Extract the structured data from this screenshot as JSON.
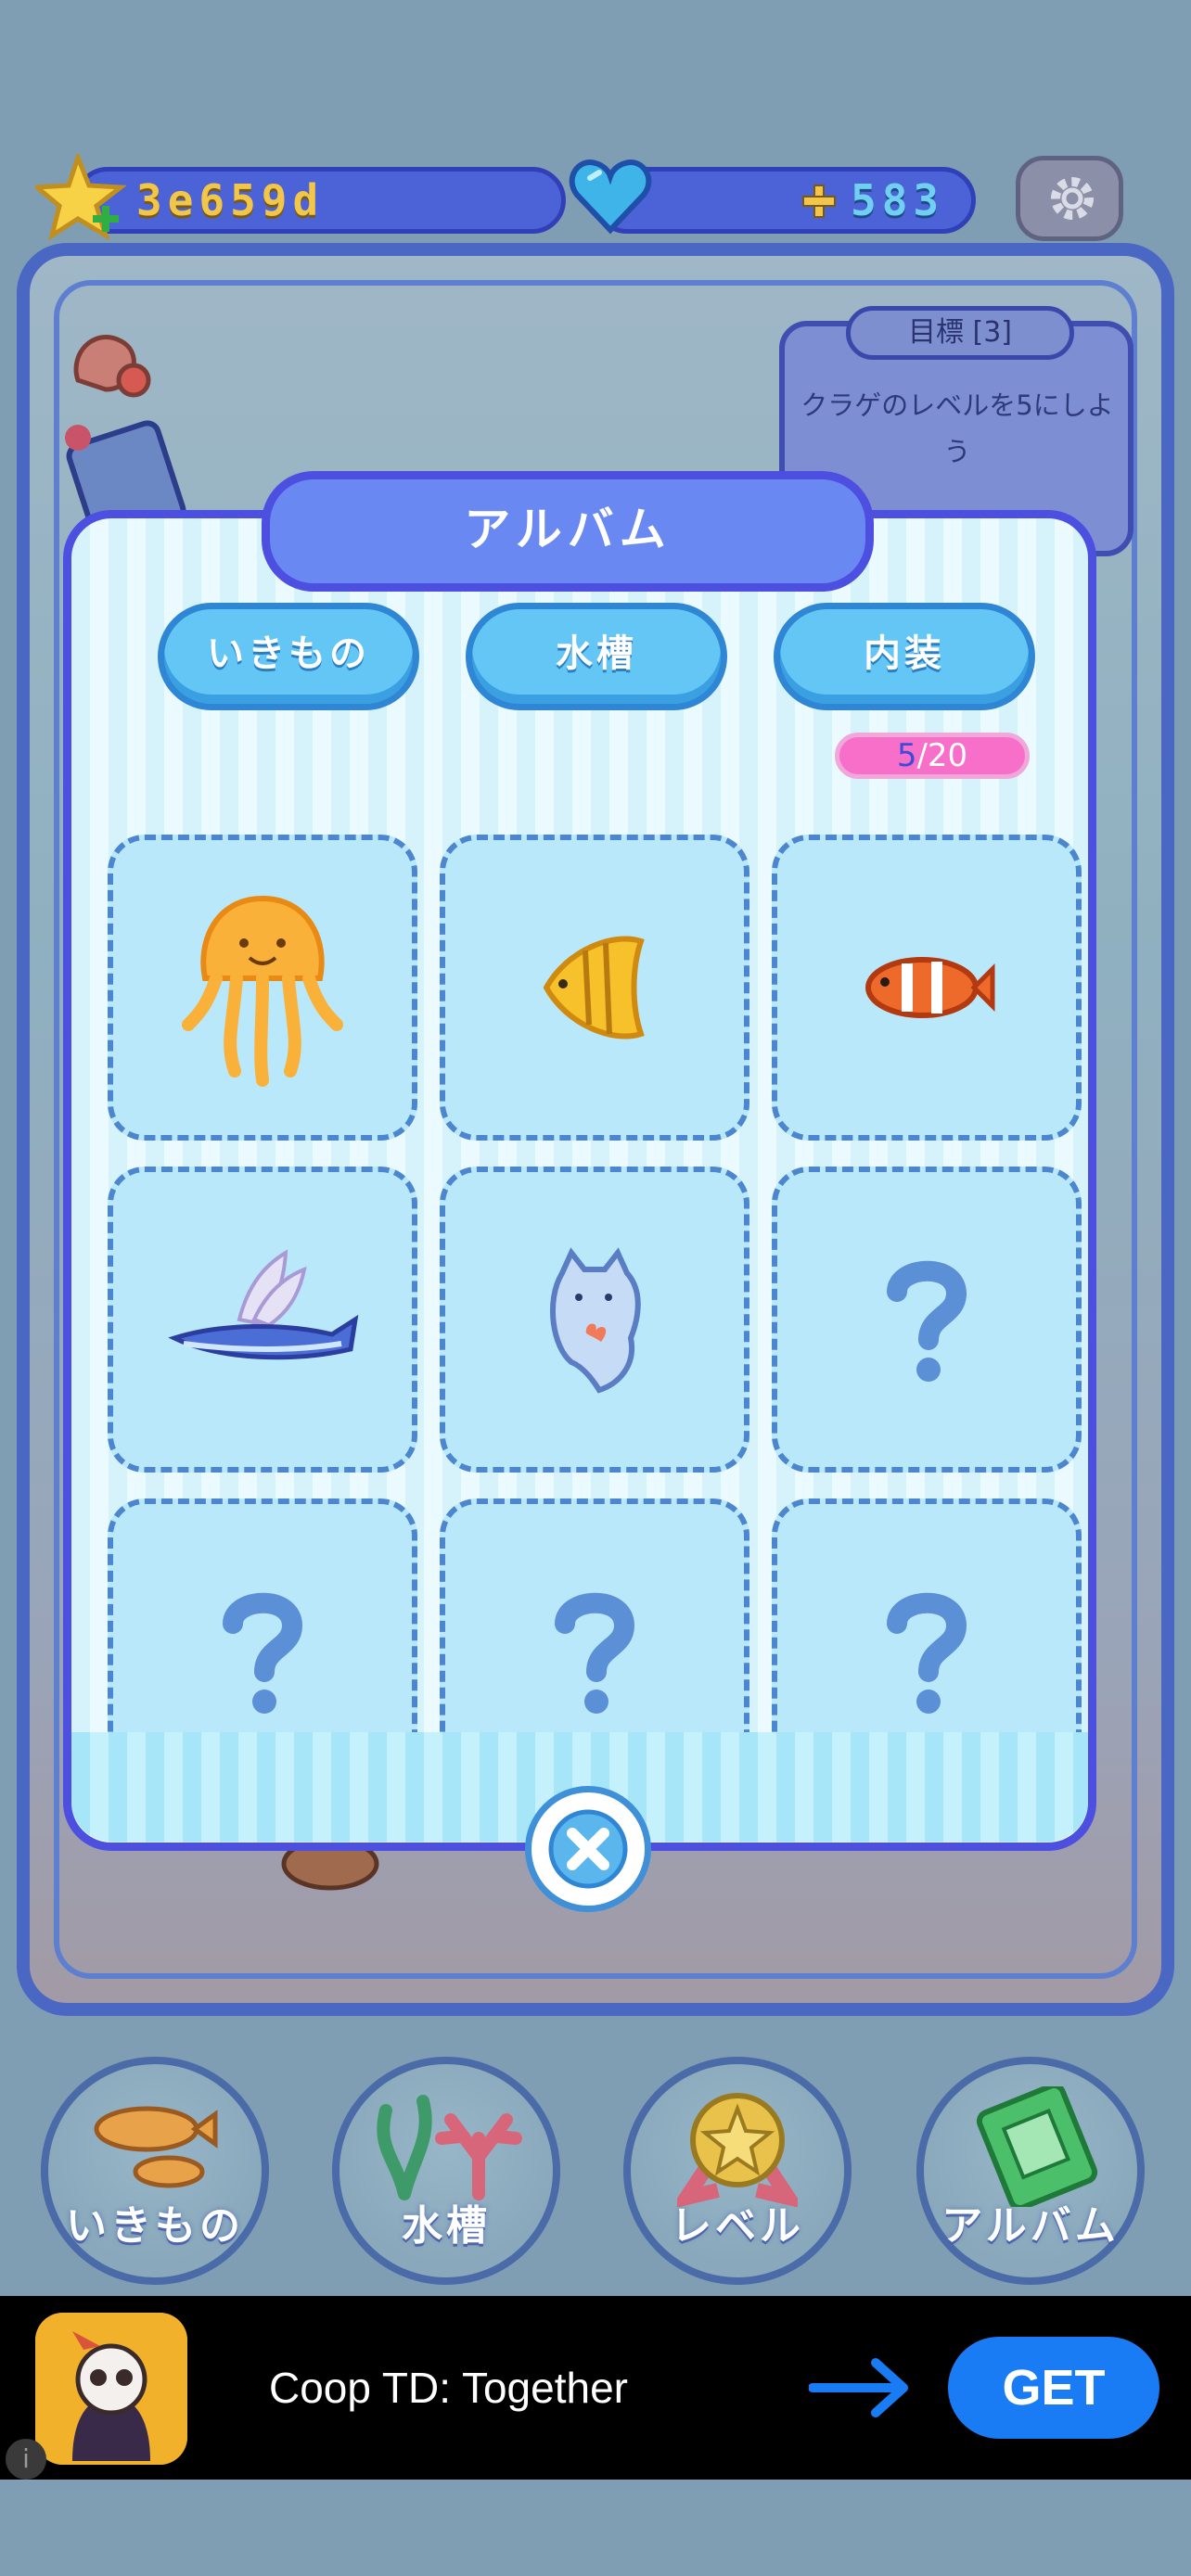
{
  "top_bar": {
    "id_code": "3e659d",
    "gems": "583",
    "icons": [
      "star-plus-icon",
      "heart-gem-icon",
      "plus-icon",
      "gear-icon"
    ]
  },
  "goal": {
    "title": "目標 [3]",
    "text": "クラゲのレベルを5にしよう"
  },
  "album": {
    "title": "アルバム",
    "tabs": [
      {
        "label": "いきもの"
      },
      {
        "label": "水槽"
      },
      {
        "label": "内装"
      }
    ],
    "count_current": "5",
    "count_total": "/20",
    "cells": [
      {
        "icon": "jellyfish-icon",
        "unlocked": true
      },
      {
        "icon": "angelfish-icon",
        "unlocked": true
      },
      {
        "icon": "clownfish-icon",
        "unlocked": true
      },
      {
        "icon": "flying-fish-icon",
        "unlocked": true
      },
      {
        "icon": "ghost-cat-icon",
        "unlocked": true
      },
      {
        "icon": "question-mark-icon",
        "unlocked": false
      },
      {
        "icon": "question-mark-icon",
        "unlocked": false
      },
      {
        "icon": "question-mark-icon",
        "unlocked": false
      },
      {
        "icon": "question-mark-icon",
        "unlocked": false
      }
    ]
  },
  "bottom_nav": [
    {
      "label": "いきもの",
      "icon": "fish-icon"
    },
    {
      "label": "水槽",
      "icon": "coral-icon"
    },
    {
      "label": "レベル",
      "icon": "medal-icon"
    },
    {
      "label": "アルバム",
      "icon": "album-book-icon"
    }
  ],
  "ad": {
    "title": "Coop TD: Together",
    "cta": "GET",
    "info": "i"
  },
  "colors": {
    "modal_border": "#4c4fe0",
    "tab_blue": "#63c6f4",
    "counter_pink": "#f76fc9",
    "get_button": "#1a7cf5"
  }
}
